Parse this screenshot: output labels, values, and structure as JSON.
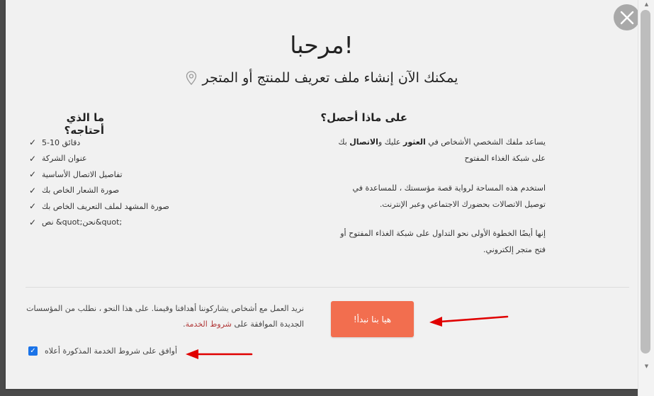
{
  "modal": {
    "title": "!مرحبا",
    "subtitle": "يمكنك الآن إنشاء ملف تعريف للمنتج أو المتجر",
    "subtitle_icon": "map-pin-icon",
    "close_icon": "close-icon"
  },
  "needs": {
    "title": "ما الذي أحتاجه؟",
    "items": [
      "دقائق 10-5",
      "عنوان الشركة",
      "تفاصيل الاتصال الأساسية",
      "صورة الشعار الخاص بك",
      "صورة المشهد لملف التعريف الخاص بك",
      "نص &quot;نحن&quot;"
    ]
  },
  "benefits": {
    "title": "على ماذا أحصل؟",
    "p1_prefix": "يساعد ملفك الشخصي الأشخاص في ",
    "p1_bold1": "العثور",
    "p1_mid": " عليك و",
    "p1_bold2": "الاتصال",
    "p1_suffix": " بك على شبكة الغذاء المفتوح",
    "p2": "استخدم هذه المساحة لرواية قصة مؤسستك ، للمساعدة في توصيل الاتصالات بحضورك الاجتماعي وعبر الإنترنت.",
    "p3": "إنها أيضًا الخطوة الأولى نحو التداول على شبكة الغذاء المفتوح أو فتح متجر إلكتروني."
  },
  "footer": {
    "terms_text": "نريد العمل مع أشخاص يشاركوننا أهدافنا وقيمنا. على هذا النحو ، نطلب من المؤسسات الجديدة الموافقة على ",
    "terms_link": "شروط الخدمة",
    "terms_end": ".",
    "cta_label": "!هيا بنا نبدأ",
    "agree_label": "أوافق على شروط الخدمة المذكورة أعلاه",
    "agree_checked": true
  },
  "colors": {
    "accent": "#f26e4f",
    "link": "#b23a3a",
    "annotation_arrow": "#e00000",
    "checkbox": "#1a73e8"
  }
}
